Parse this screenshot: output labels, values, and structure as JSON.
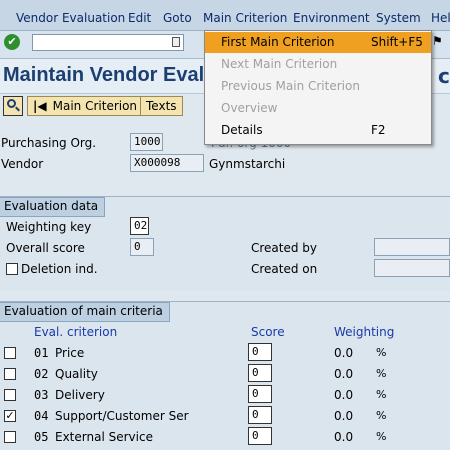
{
  "menubar": {
    "items": [
      "Vendor Evaluation",
      "Edit",
      "Goto",
      "Main Criterion",
      "Environment",
      "System",
      "Hel"
    ]
  },
  "toolbar": {
    "command_field_value": ""
  },
  "title": {
    "text": "Maintain Vendor Evalu",
    "tail": "c"
  },
  "apptoolbar": {
    "main_criterion_label": "Main Criterion",
    "texts_label": "Texts"
  },
  "header": {
    "purch_org_label": "Purchasing Org.",
    "purch_org_value": "1000",
    "purch_org_desc_partial": "Pur. org 1000",
    "vendor_label": "Vendor",
    "vendor_value": "X000098",
    "vendor_name": "Gynmstarchi"
  },
  "evaluation_data": {
    "title": "Evaluation data",
    "weighting_key_label": "Weighting key",
    "weighting_key_value": "02",
    "overall_score_label": "Overall score",
    "overall_score_value": "0",
    "deletion_label": "Deletion ind.",
    "created_by_label": "Created by",
    "created_on_label": "Created on"
  },
  "main_criteria": {
    "title": "Evaluation of main criteria",
    "col_criterion": "Eval. criterion",
    "col_score": "Score",
    "col_weighting": "Weighting",
    "rows": [
      {
        "no": "01",
        "name": "Price",
        "score": "0",
        "weight": "0.0",
        "pct": "%",
        "checked": false
      },
      {
        "no": "02",
        "name": "Quality",
        "score": "0",
        "weight": "0.0",
        "pct": "%",
        "checked": false
      },
      {
        "no": "03",
        "name": "Delivery",
        "score": "0",
        "weight": "0.0",
        "pct": "%",
        "checked": false
      },
      {
        "no": "04",
        "name": "Support/Customer Ser",
        "score": "0",
        "weight": "0.0",
        "pct": "%",
        "checked": true
      },
      {
        "no": "05",
        "name": "External Service",
        "score": "0",
        "weight": "0.0",
        "pct": "%",
        "checked": false
      }
    ]
  },
  "dropdown": {
    "items": [
      {
        "label": "First Main Criterion",
        "shortcut": "Shift+F5",
        "state": "selected"
      },
      {
        "label": "Next Main Criterion",
        "shortcut": "",
        "state": "disabled"
      },
      {
        "label": "Previous Main Criterion",
        "shortcut": "",
        "state": "disabled"
      },
      {
        "label": "Overview",
        "shortcut": "",
        "state": "disabled"
      },
      {
        "label": "Details",
        "shortcut": "F2",
        "state": "enabled"
      }
    ]
  },
  "colors": {
    "selected": "#f0a020",
    "title": "#1c3f72",
    "column_heading": "#1a3aa8"
  }
}
